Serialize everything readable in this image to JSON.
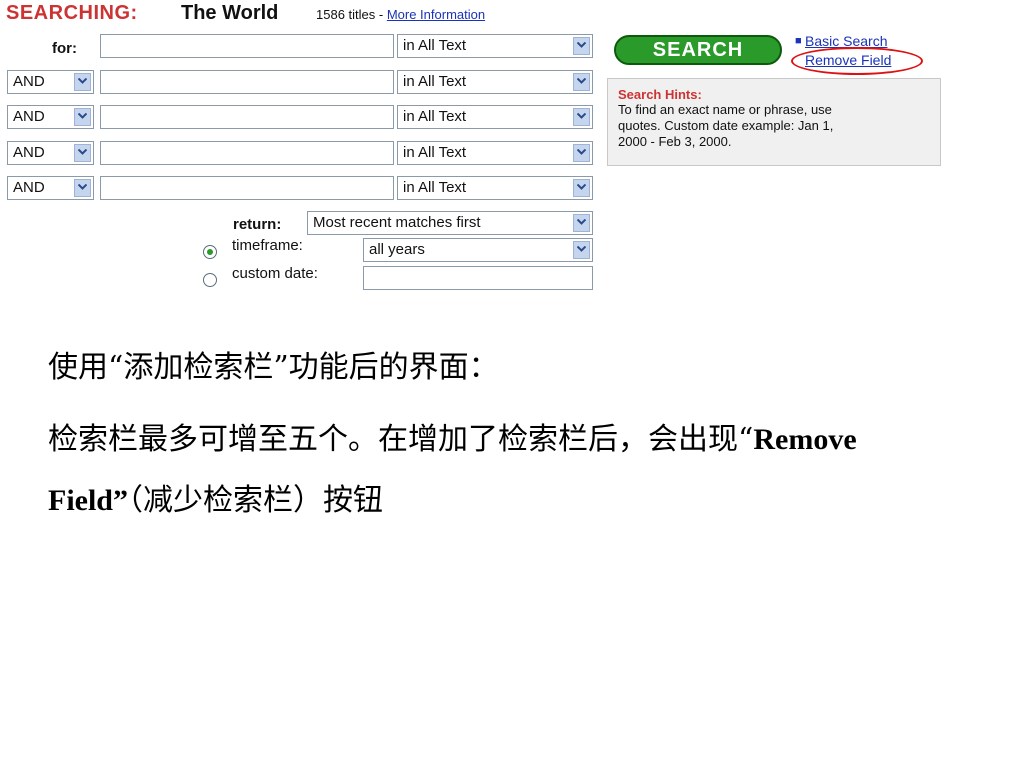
{
  "header": {
    "searching_label": "SEARCHING:",
    "database_name": "The World",
    "title_count": "1586 titles",
    "separator": " - ",
    "more_info_link": "More Information"
  },
  "form": {
    "for_label": "for:",
    "field_scope": "in All Text",
    "operator": "AND",
    "return_label": "return:",
    "return_value": "Most recent matches first",
    "timeframe_label": "timeframe:",
    "timeframe_value": "all years",
    "custom_date_label": "custom date:",
    "custom_date_value": "",
    "timeframe_selected": true
  },
  "actions": {
    "search_button": "SEARCH",
    "basic_search_link": "Basic Search",
    "remove_field_link": "Remove Field"
  },
  "hints": {
    "title": "Search Hints:",
    "line1": "To find an exact name or phrase, use",
    "line2": "quotes. Custom date example: Jan 1,",
    "line3": "2000 - Feb 3, 2000."
  },
  "caption": {
    "line1": "使用“添加检索栏”功能后的界面：",
    "line2_a": "检索栏最多可增至五个。在增加了检索栏后，会出现“",
    "line2_b": "Remove",
    "line3_a": "Field”",
    "line3_b": "（减少检索栏）按钮"
  },
  "colors": {
    "brand_red": "#cc3333",
    "search_green": "#2a9a2a",
    "link_blue": "#1a33b8",
    "highlight_ring": "#dd1111"
  }
}
